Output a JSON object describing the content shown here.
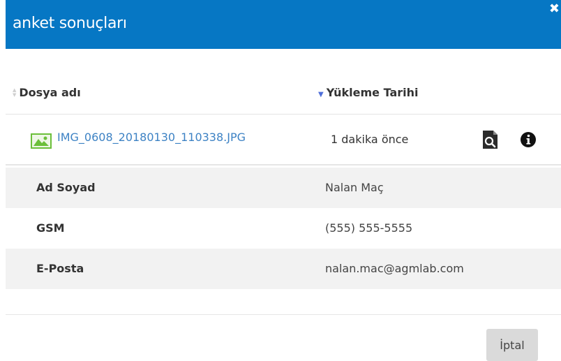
{
  "modal": {
    "title": "anket sonuçları",
    "close_label": "✖"
  },
  "table": {
    "columns": [
      {
        "label": "Dosya adı",
        "sort": "none"
      },
      {
        "label": "Yükleme Tarihi",
        "sort": "descending"
      }
    ],
    "rows": [
      {
        "file_name": "IMG_0608_20180130_110338.JPG",
        "uploaded": "1 dakika önce",
        "icons": [
          "image-file-icon",
          "preview-icon",
          "info-icon"
        ]
      }
    ]
  },
  "details": [
    {
      "label": "Ad Soyad",
      "value": "Nalan Maç"
    },
    {
      "label": "GSM",
      "value": "(555) 555-5555"
    },
    {
      "label": "E-Posta",
      "value": "nalan.mac@agmlab.com"
    }
  ],
  "footer": {
    "cancel_label": "İptal"
  },
  "colors": {
    "header": "#0677c4",
    "link": "#3d82c4",
    "sort_active": "#4f6fd9",
    "row_shade": "#f2f2f2",
    "file_icon": "#6bbf3a"
  }
}
